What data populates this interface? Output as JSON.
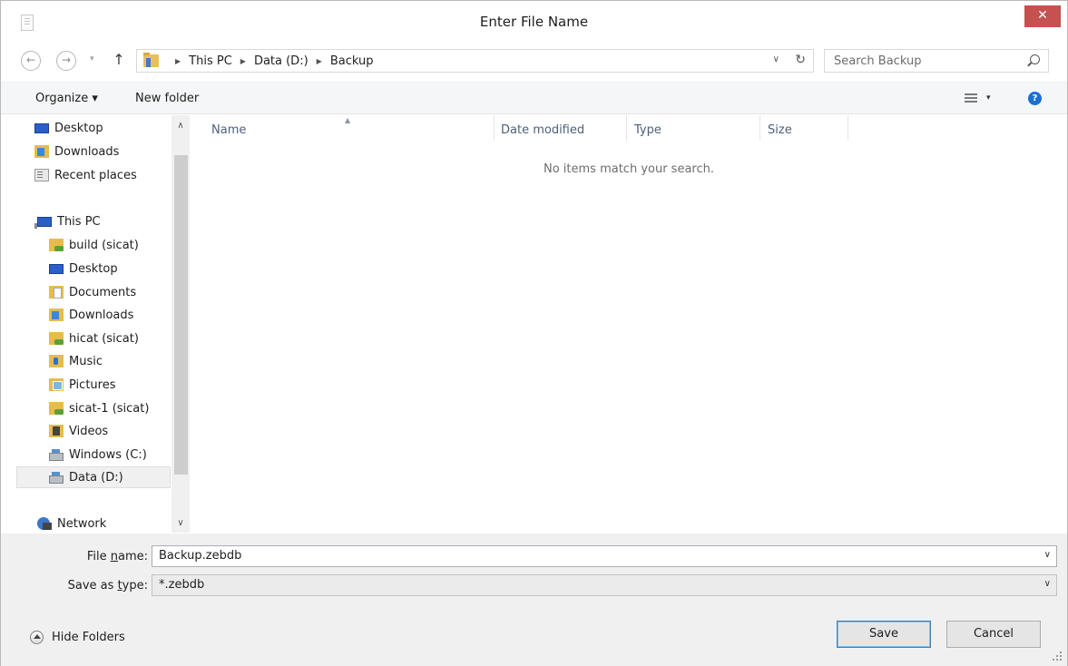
{
  "window": {
    "title": "Enter File Name",
    "close_glyph": "✕"
  },
  "nav": {
    "back_glyph": "←",
    "forward_glyph": "→",
    "recent_dropdown_glyph": "▾",
    "up_glyph": "↑",
    "breadcrumbs": [
      "This PC",
      "Data (D:)",
      "Backup"
    ],
    "crumb_separator": "▶",
    "address_dropdown_glyph": "∨",
    "refresh_glyph": "↻",
    "search_placeholder": "Search Backup"
  },
  "toolbar": {
    "organize_label": "Organize ▾",
    "new_folder_label": "New folder",
    "view_dropdown_glyph": "▾",
    "help_glyph": "?"
  },
  "sidebar": {
    "scroll_up_glyph": "∧",
    "scroll_down_glyph": "∨",
    "items": [
      {
        "label": "Desktop",
        "icon": "desktop-icon"
      },
      {
        "label": "Downloads",
        "icon": "downloads-folder-icon"
      },
      {
        "label": "Recent places",
        "icon": "recent-places-icon"
      },
      {
        "label": "This PC",
        "icon": "this-pc-icon"
      },
      {
        "label": "build (sicat)",
        "icon": "network-share-folder-icon"
      },
      {
        "label": "Desktop",
        "icon": "desktop-folder-icon"
      },
      {
        "label": "Documents",
        "icon": "documents-folder-icon"
      },
      {
        "label": "Downloads",
        "icon": "downloads-folder-icon"
      },
      {
        "label": "hicat (sicat)",
        "icon": "network-share-folder-icon"
      },
      {
        "label": "Music",
        "icon": "music-folder-icon"
      },
      {
        "label": "Pictures",
        "icon": "pictures-folder-icon"
      },
      {
        "label": "sicat-1 (sicat)",
        "icon": "network-share-folder-icon"
      },
      {
        "label": "Videos",
        "icon": "videos-folder-icon"
      },
      {
        "label": "Windows (C:)",
        "icon": "drive-icon"
      },
      {
        "label": "Data (D:)",
        "icon": "drive-icon",
        "selected": true
      },
      {
        "label": "Network",
        "icon": "network-icon"
      }
    ]
  },
  "file_list": {
    "sort_glyph": "▲",
    "columns": [
      "Name",
      "Date modified",
      "Type",
      "Size"
    ],
    "empty_message": "No items match your search."
  },
  "form": {
    "file_name_label_prefix": "File ",
    "file_name_label_access": "n",
    "file_name_label_suffix": "ame:",
    "file_name_value": "Backup.zebdb",
    "save_type_label_prefix": "Save as ",
    "save_type_label_access": "t",
    "save_type_label_suffix": "ype:",
    "save_type_value": "*.zebdb",
    "dropdown_glyph": "∨"
  },
  "footer": {
    "hide_folders_label": "Hide Folders",
    "save_label": "Save",
    "cancel_label": "Cancel"
  }
}
